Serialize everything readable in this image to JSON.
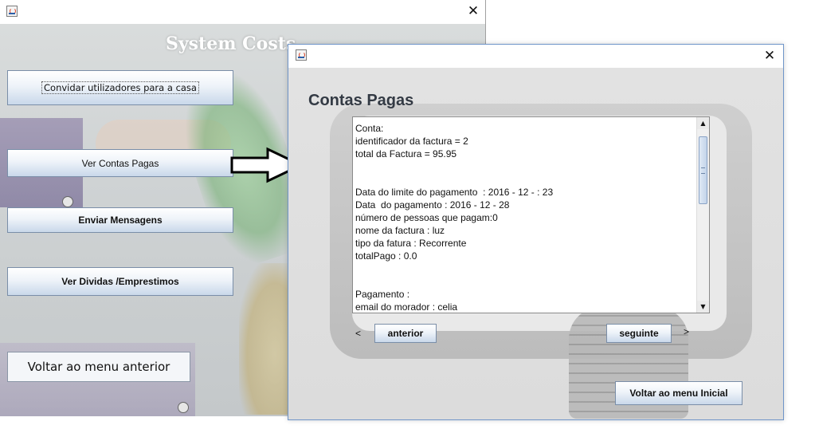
{
  "back_window": {
    "app_title": "System Costs",
    "buttons": {
      "invite": "Convidar utilizadores para a casa",
      "view_paid": "Ver Contas Pagas",
      "send_messages": "Enviar Mensagens",
      "view_debts": "Ver Dividas /Emprestimos",
      "back_previous": "Voltar ao menu anterior"
    },
    "close_glyph": "✕"
  },
  "front_window": {
    "title": "Contas Pagas",
    "close_glyph": "✕",
    "text_lines": [
      "Conta:",
      "identificador da factura = 2",
      "total da Factura = 95.95",
      "",
      "",
      "Data do limite do pagamento  : 2016 - 12 - : 23",
      "Data  do pagamento : 2016 - 12 - 28",
      "número de pessoas que pagam:0",
      "nome da factura : luz",
      "tipo da fatura : Recorrente",
      "totalPago : 0.0",
      "",
      "",
      "Pagamento :",
      "email do morador : celia"
    ],
    "scroll_up": "▲",
    "scroll_down": "▼",
    "prev_glyph": "<",
    "next_glyph": ">",
    "buttons": {
      "previous": "anterior",
      "next": "seguinte",
      "main_menu": "Voltar ao menu Inicial"
    }
  },
  "icons": [
    "java-app-icon",
    "close-icon",
    "right-arrow-icon"
  ]
}
